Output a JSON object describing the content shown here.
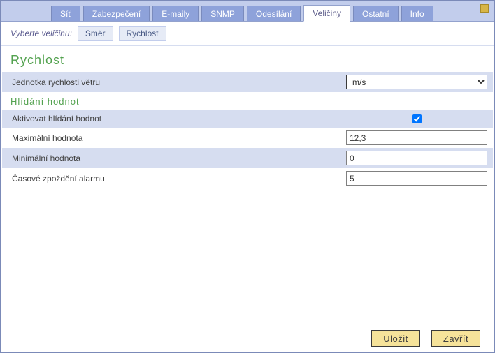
{
  "tabs": {
    "items": [
      {
        "label": "Síť",
        "active": false
      },
      {
        "label": "Zabezpečení",
        "active": false
      },
      {
        "label": "E-maily",
        "active": false
      },
      {
        "label": "SNMP",
        "active": false
      },
      {
        "label": "Odesílání",
        "active": false
      },
      {
        "label": "Veličiny",
        "active": true
      },
      {
        "label": "Ostatní",
        "active": false
      },
      {
        "label": "Info",
        "active": false
      }
    ]
  },
  "subtabs": {
    "prompt": "Vyberte veličinu:",
    "items": [
      {
        "label": "Směr"
      },
      {
        "label": "Rychlost"
      }
    ]
  },
  "section": {
    "title": "Rychlost",
    "unit": {
      "label": "Jednotka rychlosti větru",
      "value": "m/s",
      "options": [
        "m/s"
      ]
    },
    "monitoring_title": "Hlídání hodnot",
    "activate": {
      "label": "Aktivovat hlídání hodnot",
      "checked": true
    },
    "max": {
      "label": "Maximální hodnota",
      "value": "12,3"
    },
    "min": {
      "label": "Minimální hodnota",
      "value": "0"
    },
    "delay": {
      "label": "Časové zpoždění alarmu",
      "value": "5"
    }
  },
  "footer": {
    "save": "Uložit",
    "close": "Zavřít"
  }
}
